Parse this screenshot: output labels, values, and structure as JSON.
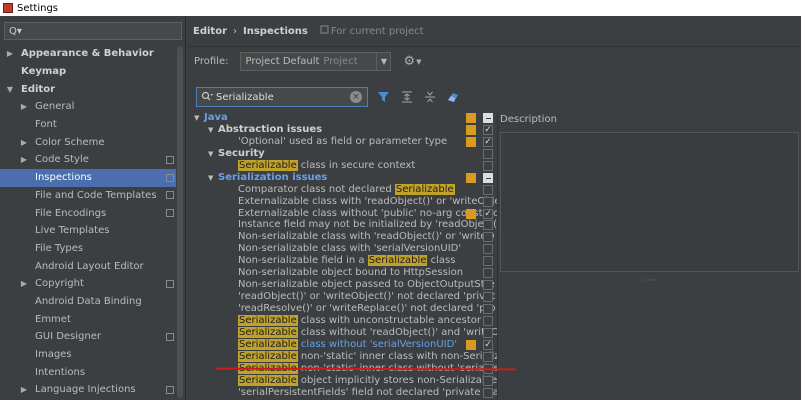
{
  "window": {
    "title": "Settings"
  },
  "left": {
    "search_placeholder": "Q▾",
    "items": [
      {
        "label": "Appearance & Behavior",
        "arrow": "▶",
        "bold": true,
        "indent": 0
      },
      {
        "label": "Keymap",
        "arrow": "",
        "bold": true,
        "indent": 0
      },
      {
        "label": "Editor",
        "arrow": "▼",
        "bold": true,
        "indent": 0
      },
      {
        "label": "General",
        "arrow": "▶",
        "bold": false,
        "indent": 1
      },
      {
        "label": "Font",
        "arrow": "",
        "bold": false,
        "indent": 1
      },
      {
        "label": "Color Scheme",
        "arrow": "▶",
        "bold": false,
        "indent": 1
      },
      {
        "label": "Code Style",
        "arrow": "▶",
        "bold": false,
        "indent": 1,
        "proj": true
      },
      {
        "label": "Inspections",
        "arrow": "",
        "bold": false,
        "indent": 1,
        "proj": true,
        "selected": true
      },
      {
        "label": "File and Code Templates",
        "arrow": "",
        "bold": false,
        "indent": 1,
        "proj": true
      },
      {
        "label": "File Encodings",
        "arrow": "",
        "bold": false,
        "indent": 1,
        "proj": true
      },
      {
        "label": "Live Templates",
        "arrow": "",
        "bold": false,
        "indent": 1
      },
      {
        "label": "File Types",
        "arrow": "",
        "bold": false,
        "indent": 1
      },
      {
        "label": "Android Layout Editor",
        "arrow": "",
        "bold": false,
        "indent": 1
      },
      {
        "label": "Copyright",
        "arrow": "▶",
        "bold": false,
        "indent": 1,
        "proj": true
      },
      {
        "label": "Android Data Binding",
        "arrow": "",
        "bold": false,
        "indent": 1
      },
      {
        "label": "Emmet",
        "arrow": "",
        "bold": false,
        "indent": 1
      },
      {
        "label": "GUI Designer",
        "arrow": "",
        "bold": false,
        "indent": 1,
        "proj": true
      },
      {
        "label": "Images",
        "arrow": "",
        "bold": false,
        "indent": 1
      },
      {
        "label": "Intentions",
        "arrow": "",
        "bold": false,
        "indent": 1
      },
      {
        "label": "Language Injections",
        "arrow": "▶",
        "bold": false,
        "indent": 1,
        "proj": true
      }
    ]
  },
  "breadcrumb": {
    "editor": "Editor",
    "sep": "›",
    "inspections": "Inspections",
    "scope": "For current project"
  },
  "profile": {
    "label": "Profile:",
    "value": "Project Default",
    "suffix": "Project"
  },
  "filter": {
    "value": "Serializable"
  },
  "description": {
    "label": "Description"
  },
  "colors": {
    "selection": "#4b6eaf",
    "highlight": "#bfa12b",
    "severity": "#d89b1f",
    "link": "#6aa0e8",
    "annotation": "#d11a1a"
  },
  "tree": [
    {
      "indent": 0,
      "arrow": "▼",
      "style": "java",
      "parts": [
        {
          "t": "Java"
        }
      ],
      "sev": true,
      "chk": "minus"
    },
    {
      "indent": 1,
      "arrow": "▼",
      "style": "cat",
      "parts": [
        {
          "t": "Abstraction issues"
        }
      ],
      "sev": true,
      "chk": "check"
    },
    {
      "indent": 2,
      "arrow": "",
      "style": "",
      "parts": [
        {
          "t": "'Optional' used as field or parameter type"
        }
      ],
      "sev": true,
      "chk": "check"
    },
    {
      "indent": 1,
      "arrow": "▼",
      "style": "cat",
      "parts": [
        {
          "t": "Security"
        }
      ],
      "sev": false,
      "chk": "empty"
    },
    {
      "indent": 2,
      "arrow": "",
      "style": "",
      "parts": [
        {
          "t": "Serializable",
          "h": true
        },
        {
          "t": " class in secure context"
        }
      ],
      "sev": false,
      "chk": "empty"
    },
    {
      "indent": 1,
      "arrow": "▼",
      "style": "ser",
      "parts": [
        {
          "t": "Serialization issues"
        }
      ],
      "sev": true,
      "chk": "minus"
    },
    {
      "indent": 2,
      "arrow": "",
      "style": "",
      "parts": [
        {
          "t": "Comparator class not declared "
        },
        {
          "t": "Serializable",
          "h": true
        }
      ],
      "sev": false,
      "chk": "empty"
    },
    {
      "indent": 2,
      "arrow": "",
      "style": "",
      "parts": [
        {
          "t": "Externalizable class with 'readObject()' or 'writeObje"
        }
      ],
      "sev": false,
      "chk": "empty"
    },
    {
      "indent": 2,
      "arrow": "",
      "style": "",
      "parts": [
        {
          "t": "Externalizable class without 'public' no-arg construc"
        }
      ],
      "sev": true,
      "chk": "check"
    },
    {
      "indent": 2,
      "arrow": "",
      "style": "",
      "parts": [
        {
          "t": "Instance field may not be initialized by 'readObject("
        }
      ],
      "sev": false,
      "chk": "empty"
    },
    {
      "indent": 2,
      "arrow": "",
      "style": "",
      "parts": [
        {
          "t": "Non-serializable class with 'readObject()' or 'writeO"
        }
      ],
      "sev": false,
      "chk": "empty"
    },
    {
      "indent": 2,
      "arrow": "",
      "style": "",
      "parts": [
        {
          "t": "Non-serializable class with 'serialVersionUID'"
        }
      ],
      "sev": false,
      "chk": "empty"
    },
    {
      "indent": 2,
      "arrow": "",
      "style": "",
      "parts": [
        {
          "t": "Non-serializable field in a "
        },
        {
          "t": "Serializable",
          "h": true
        },
        {
          "t": " class"
        }
      ],
      "sev": false,
      "chk": "empty"
    },
    {
      "indent": 2,
      "arrow": "",
      "style": "",
      "parts": [
        {
          "t": "Non-serializable object bound to HttpSession"
        }
      ],
      "sev": false,
      "chk": "empty"
    },
    {
      "indent": 2,
      "arrow": "",
      "style": "",
      "parts": [
        {
          "t": "Non-serializable object passed to ObjectOutputStre"
        }
      ],
      "sev": false,
      "chk": "empty"
    },
    {
      "indent": 2,
      "arrow": "",
      "style": "",
      "parts": [
        {
          "t": "'readObject()' or 'writeObject()' not declared 'privat"
        }
      ],
      "sev": false,
      "chk": "empty"
    },
    {
      "indent": 2,
      "arrow": "",
      "style": "",
      "parts": [
        {
          "t": "'readResolve()' or 'writeReplace()' not declared 'pro"
        }
      ],
      "sev": false,
      "chk": "empty"
    },
    {
      "indent": 2,
      "arrow": "",
      "style": "",
      "parts": [
        {
          "t": "Serializable",
          "h": true
        },
        {
          "t": " class with unconstructable ancestor"
        }
      ],
      "sev": false,
      "chk": "empty"
    },
    {
      "indent": 2,
      "arrow": "",
      "style": "",
      "parts": [
        {
          "t": "Serializable",
          "h": true
        },
        {
          "t": " class without 'readObject()' and 'writeO"
        }
      ],
      "sev": false,
      "chk": "empty"
    },
    {
      "indent": 2,
      "arrow": "",
      "style": "",
      "parts": [
        {
          "t": "Serializable",
          "h": true
        },
        {
          "t": " class without 'serialVersionUID'",
          "l": true
        }
      ],
      "sev": true,
      "chk": "check"
    },
    {
      "indent": 2,
      "arrow": "",
      "style": "",
      "parts": [
        {
          "t": "Serializable",
          "h": true
        },
        {
          "t": " non-'static' inner class with non-Serializ"
        }
      ],
      "sev": false,
      "chk": "empty"
    },
    {
      "indent": 2,
      "arrow": "",
      "style": "",
      "parts": [
        {
          "t": "Serializable",
          "h": true
        },
        {
          "t": " non-'static' inner class without 'serialVe"
        }
      ],
      "sev": false,
      "chk": "empty"
    },
    {
      "indent": 2,
      "arrow": "",
      "style": "",
      "parts": [
        {
          "t": "Serializable",
          "h": true
        },
        {
          "t": " object implicitly stores non-Serializable"
        }
      ],
      "sev": false,
      "chk": "empty"
    },
    {
      "indent": 2,
      "arrow": "",
      "style": "",
      "parts": [
        {
          "t": "'serialPersistentFields' field not declared 'private sta"
        }
      ],
      "sev": false,
      "chk": "empty"
    }
  ]
}
